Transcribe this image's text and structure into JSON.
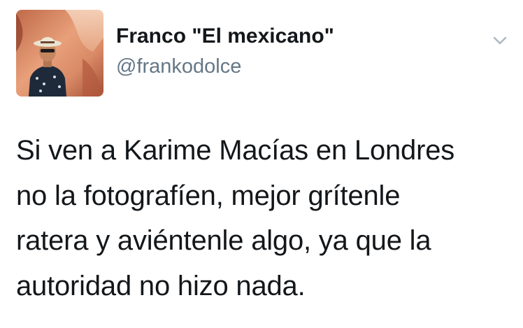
{
  "tweet": {
    "author": {
      "display_name": "Franco \"El mexicano\"",
      "handle": "@frankodolce",
      "avatar": "profile-photo"
    },
    "menu_icon": "chevron-down-icon",
    "text_lines": [
      "Si ven a Karime Macías en Londres",
      "no la fotografíen, mejor grítenle",
      "ratera y aviéntenle algo, ya que la",
      "autoridad no hizo nada."
    ]
  }
}
